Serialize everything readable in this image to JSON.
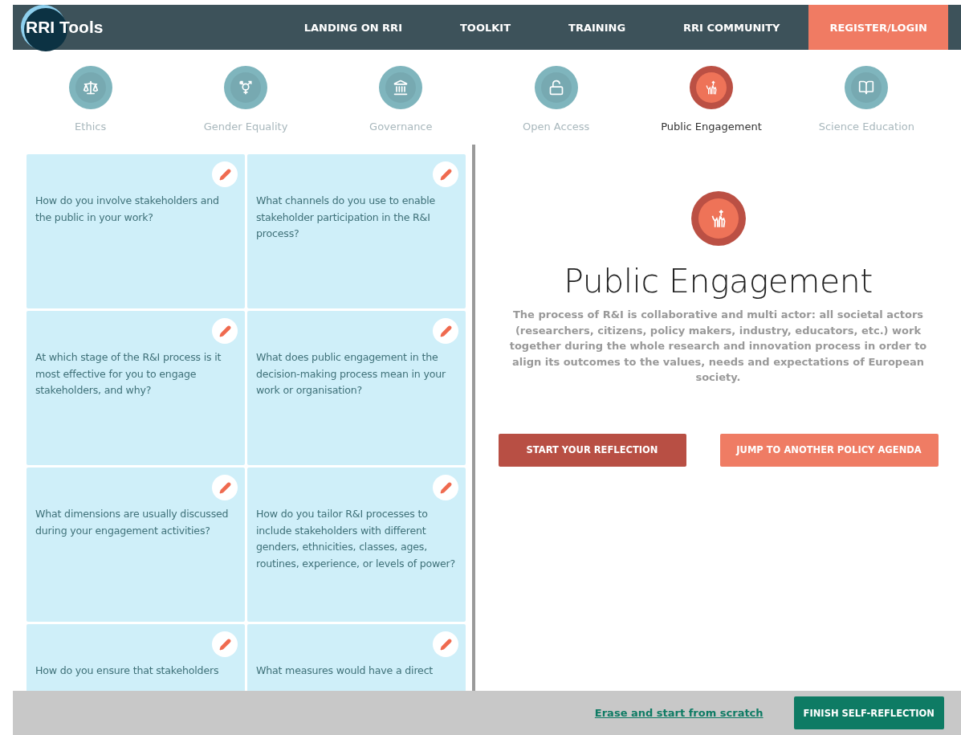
{
  "header": {
    "logo": "RRI Tools",
    "nav": [
      {
        "label": "LANDING ON RRI",
        "kind": "link"
      },
      {
        "label": "TOOLKIT",
        "kind": "link"
      },
      {
        "label": "TRAINING",
        "kind": "link"
      },
      {
        "label": "RRI COMMUNITY",
        "kind": "link"
      },
      {
        "label": "REGISTER/LOGIN",
        "kind": "cta"
      }
    ]
  },
  "agendas": [
    {
      "label": "Ethics",
      "selected": false
    },
    {
      "label": "Gender Equality",
      "selected": false
    },
    {
      "label": "Governance",
      "selected": false
    },
    {
      "label": "Open Access",
      "selected": false
    },
    {
      "label": "Public Engagement",
      "selected": true
    },
    {
      "label": "Science Education",
      "selected": false
    }
  ],
  "questions": [
    "How do you involve stakeholders and the public in your work?",
    "What channels do you use to enable stakeholder participation in the R&I process?",
    "At which stage of the R&I process is it most effective for you to engage stakeholders, and why?",
    "What does public engagement in the decision-making process mean in your work or organisation?",
    "What dimensions are usually discussed during your engagement activities?",
    "How do you tailor R&I processes to include stakeholders with different genders, ethnicities, classes, ages, routines, experience, or levels of power?",
    "How do you ensure that stakeholders",
    "What measures would have a direct"
  ],
  "detail": {
    "title": "Public Engagement",
    "description": "The process of R&I is collaborative and multi actor: all societal actors (researchers, citizens, policy makers, industry, educators, etc.) work together during the whole research and innovation process in order to align its outcomes to the values, needs and expectations of European society.",
    "buttons": [
      {
        "label": "START YOUR REFLECTION",
        "kind": "primary"
      },
      {
        "label": "JUMP TO ANOTHER POLICY AGENDA",
        "kind": "secondary"
      }
    ]
  },
  "footer": {
    "link": "Erase and start from scratch",
    "button": "FINISH SELF-REFLECTION"
  }
}
